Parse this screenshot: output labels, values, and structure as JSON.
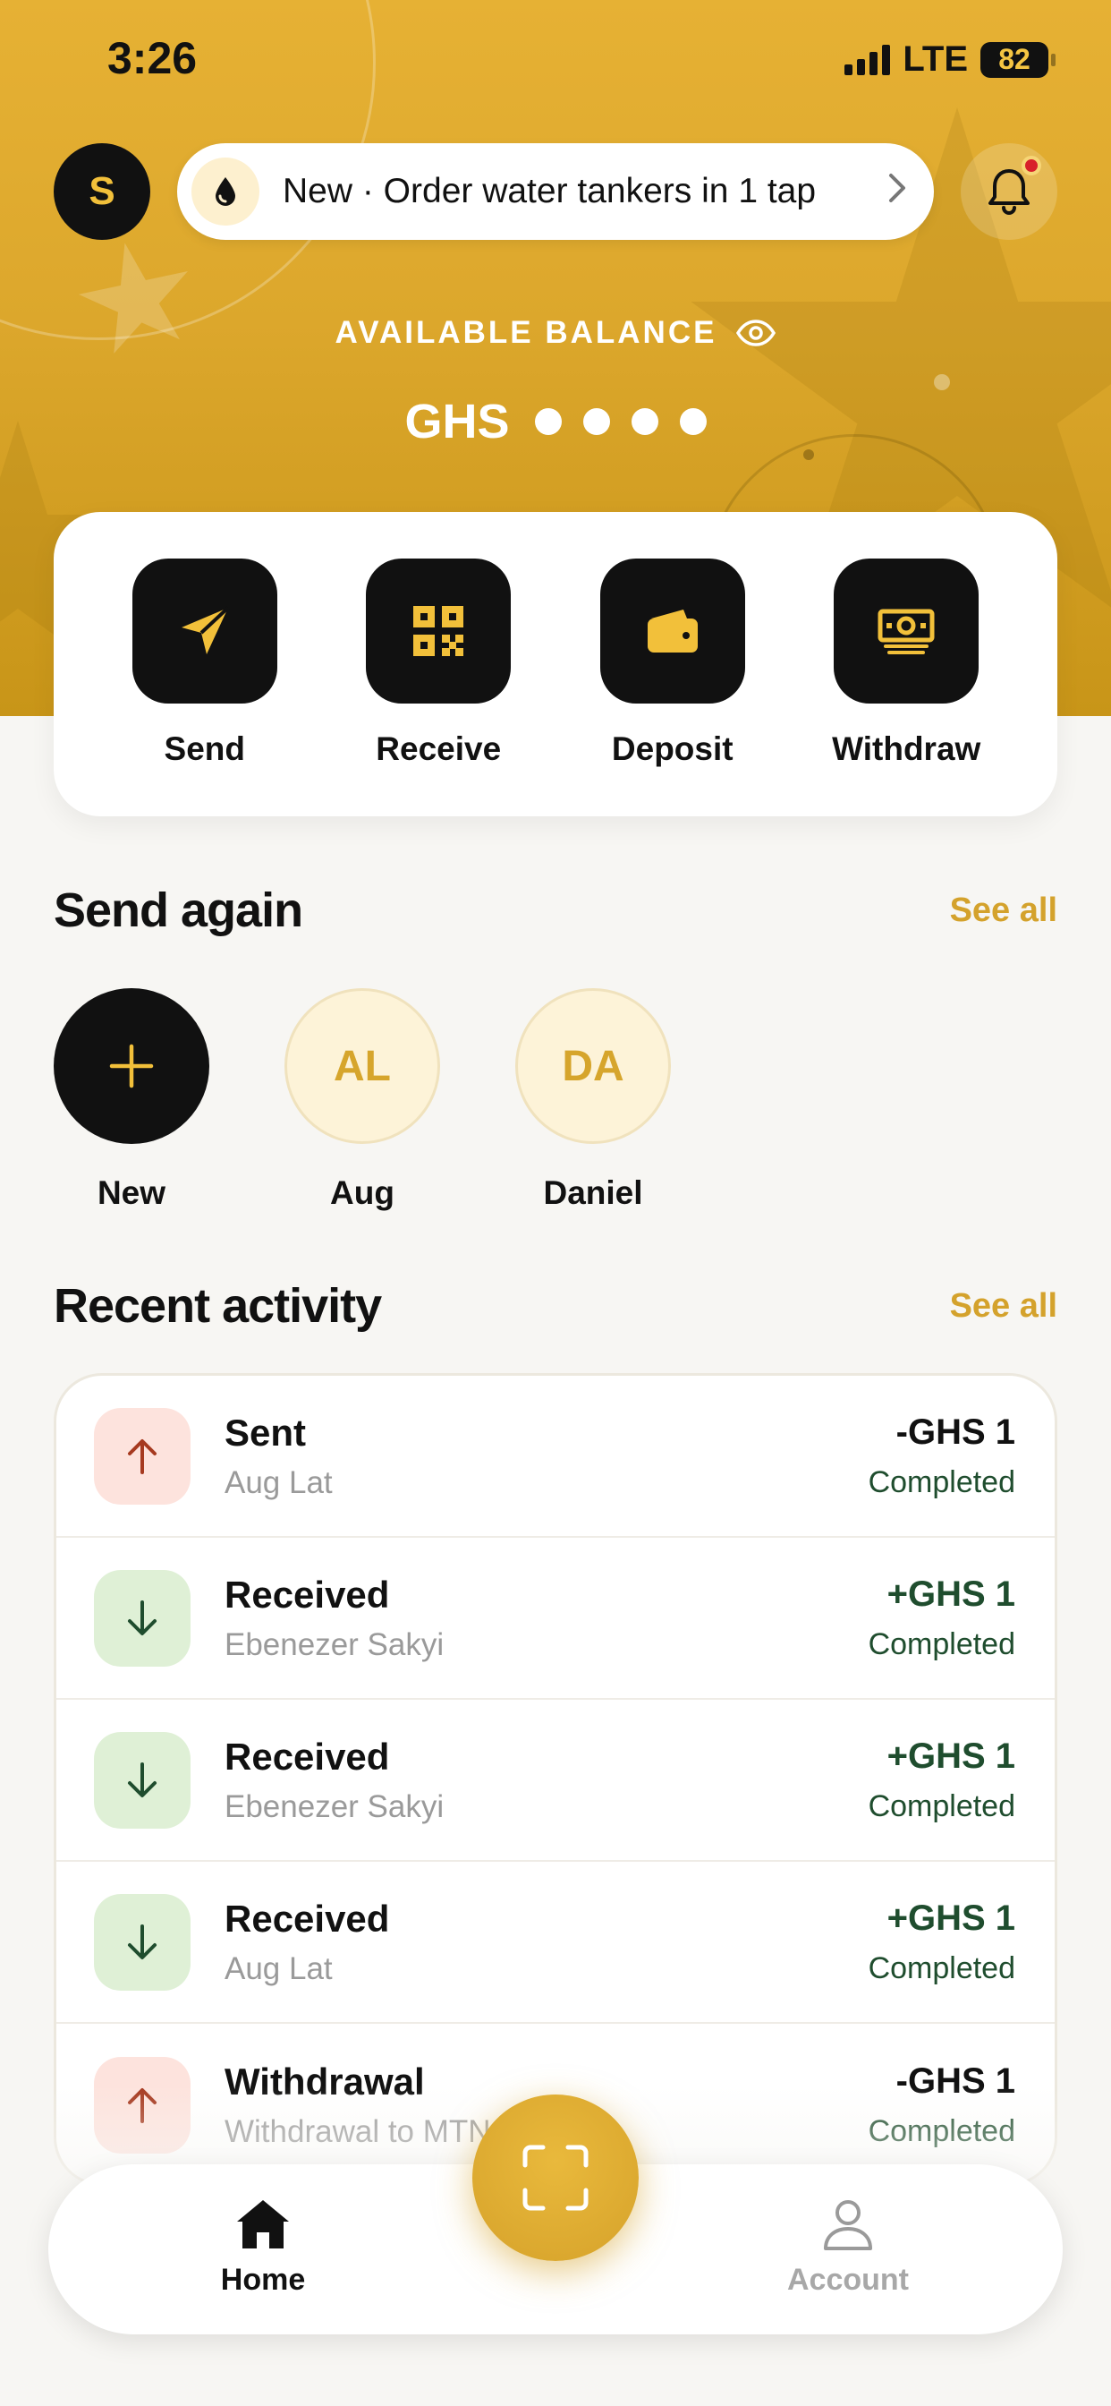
{
  "status_bar": {
    "time": "3:26",
    "network": "LTE",
    "battery": "82"
  },
  "header": {
    "avatar_initial": "S",
    "promo_text": "New · Order water tankers in 1 tap",
    "balance_label": "AVAILABLE BALANCE",
    "currency": "GHS"
  },
  "actions": [
    {
      "label": "Send",
      "icon": "send-icon"
    },
    {
      "label": "Receive",
      "icon": "qr-code-icon"
    },
    {
      "label": "Deposit",
      "icon": "wallet-icon"
    },
    {
      "label": "Withdraw",
      "icon": "cash-icon"
    }
  ],
  "send_again": {
    "title": "Send again",
    "see_all": "See all",
    "contacts": [
      {
        "initials": "",
        "name": "New"
      },
      {
        "initials": "AL",
        "name": "Aug"
      },
      {
        "initials": "DA",
        "name": "Daniel"
      }
    ]
  },
  "recent_activity": {
    "title": "Recent activity",
    "see_all": "See all",
    "items": [
      {
        "title": "Sent",
        "subtitle": "Aug Lat",
        "amount": "-GHS 1",
        "status": "Completed",
        "direction": "out"
      },
      {
        "title": "Received",
        "subtitle": "Ebenezer Sakyi",
        "amount": "+GHS 1",
        "status": "Completed",
        "direction": "in"
      },
      {
        "title": "Received",
        "subtitle": "Ebenezer Sakyi",
        "amount": "+GHS 1",
        "status": "Completed",
        "direction": "in"
      },
      {
        "title": "Received",
        "subtitle": "Aug Lat",
        "amount": "+GHS 1",
        "status": "Completed",
        "direction": "in"
      },
      {
        "title": "Withdrawal",
        "subtitle": "Withdrawal to MTN",
        "amount": "-GHS 1",
        "status": "Completed",
        "direction": "out"
      }
    ]
  },
  "bottom_nav": {
    "home": "Home",
    "account": "Account"
  },
  "colors": {
    "brand": "#e3ad30",
    "accent_text": "#d4a22c",
    "dark": "#111111",
    "positive": "#1f4d2e",
    "negative_bg": "#fde3dd",
    "positive_bg": "#dff0d6"
  }
}
